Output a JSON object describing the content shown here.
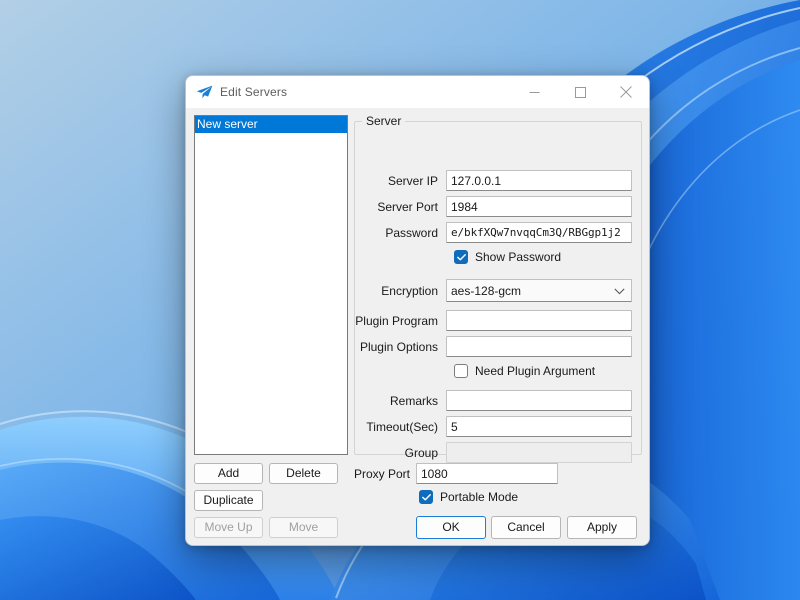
{
  "desktop": {
    "wallpaper_name": "windows-11-bloom-blue"
  },
  "window": {
    "title": "Edit Servers",
    "icon": "paper-plane-icon",
    "controls": {
      "minimize": "minimize-icon",
      "maximize": "maximize-icon",
      "close": "close-icon"
    }
  },
  "server_list": {
    "items": [
      "New server"
    ],
    "selected_index": 0
  },
  "list_buttons": [
    {
      "label": "Add",
      "name": "add-button",
      "enabled": true
    },
    {
      "label": "Delete",
      "name": "delete-button",
      "enabled": true
    },
    {
      "label": "Duplicate",
      "name": "duplicate-button",
      "enabled": true
    },
    {
      "label": "Move Up",
      "name": "move-up-button",
      "enabled": false
    },
    {
      "label": "Move",
      "name": "move-button",
      "enabled": false
    }
  ],
  "group": {
    "legend": "Server",
    "fields": {
      "server_ip": {
        "label": "Server IP",
        "value": "127.0.0.1"
      },
      "server_port": {
        "label": "Server Port",
        "value": "1984"
      },
      "password": {
        "label": "Password",
        "value": "e/bkfXQw7nvqqCm3Q/RBGgp1j2"
      },
      "encryption": {
        "label": "Encryption",
        "value": "aes-128-gcm"
      },
      "plugin_program": {
        "label": "Plugin Program",
        "value": ""
      },
      "plugin_options": {
        "label": "Plugin Options",
        "value": ""
      },
      "remarks": {
        "label": "Remarks",
        "value": ""
      },
      "timeout": {
        "label": "Timeout(Sec)",
        "value": "5"
      },
      "group_field": {
        "label": "Group",
        "value": ""
      }
    },
    "checkboxes": {
      "show_password": {
        "label": "Show Password",
        "checked": true
      },
      "need_plugin_argument": {
        "label": "Need Plugin Argument",
        "checked": false
      }
    }
  },
  "bottom": {
    "proxy_port": {
      "label": "Proxy Port",
      "value": "1080"
    },
    "portable_mode": {
      "label": "Portable Mode",
      "checked": true
    },
    "ok_label": "OK",
    "cancel_label": "Cancel",
    "apply_label": "Apply"
  },
  "colors": {
    "accent": "#0078d7",
    "checkbox_blue": "#0f6cbd",
    "dialog_bg": "#f0f0f0",
    "titlebar_bg": "#ffffff"
  }
}
